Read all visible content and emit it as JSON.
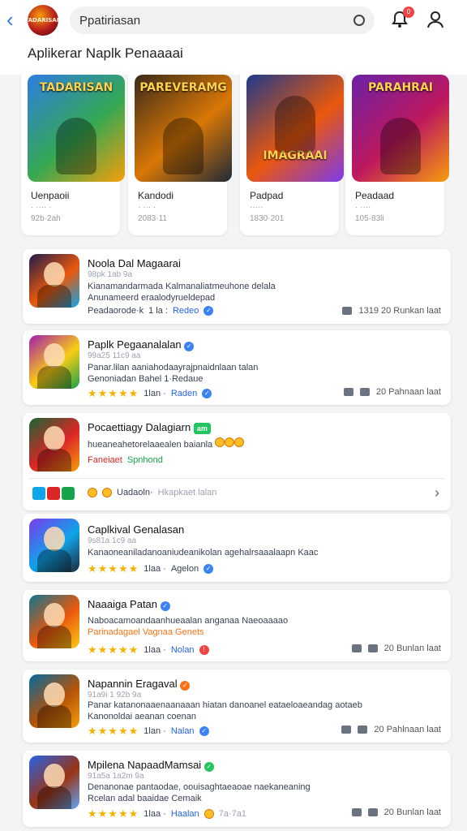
{
  "header": {
    "logo_text": "TADARISAN",
    "search": {
      "value": "Ppatiriasan",
      "placeholder": ""
    },
    "notification_count": "0",
    "subtitle": "Aplikerar Naplk  Penaaaai"
  },
  "featured": [
    {
      "art_title": "TADARISAN",
      "name": "Uenpaoii",
      "meta1": "· ···· ·",
      "meta2": "92b·2ah",
      "colors": [
        "#2f7de1",
        "#35a853",
        "#f59e0b"
      ]
    },
    {
      "art_title": "PAREVERAMG",
      "name": "Kandodi",
      "meta1": "· ··· ·",
      "meta2": "2083·11",
      "colors": [
        "#3a2a1a",
        "#d97706",
        "#1f2937"
      ]
    },
    {
      "art_title": "IMAGRAAI",
      "name": "Padpad",
      "meta1": "·····",
      "meta2": "1830·201",
      "colors": [
        "#1e3a8a",
        "#ea580c",
        "#7c3aed"
      ]
    },
    {
      "art_title": "PARAHRAI",
      "name": "Peadaad",
      "meta1": "· ····",
      "meta2": "105·83li",
      "colors": [
        "#6b21a8",
        "#be185d",
        "#f59e0b"
      ]
    }
  ],
  "list": [
    {
      "title": "Noola Dal Magaarai",
      "meta": "98pk  1ab 9a",
      "desc1": "Kianamandarmada  Kalmanaliatmeuhone  delala",
      "desc2": "Anunameerd eraalodyrueldepad",
      "foot_left": "Peadaorode·k",
      "foot_mid": "1 la :",
      "foot_link": "Redeo",
      "right": "1319  20  Runkan laat",
      "colors": [
        "#1e1b4b",
        "#ea580c",
        "#0ea5e9"
      ]
    },
    {
      "title": "Paplk Pegaanalalan",
      "meta": "99a25  11c9 aa",
      "desc1": "Panar.lilan  aaniahodaayrajpnaidnlaan  talan",
      "desc2": "Genoniadan  Bahel  1·Redaue",
      "stars": "★★★★★",
      "foot_mid": "1lan  ·",
      "foot_link": "Raden",
      "right": "20  Pahnaan laat",
      "colors": [
        "#a21caf",
        "#facc15",
        "#16a34a"
      ]
    },
    {
      "title": "Pocaettiagy Dalagiarn",
      "tag": "am",
      "desc1": "hueaneahetorelaaealen  baianla",
      "foot_red": "Faneiaet",
      "foot_green": "Spnhond",
      "sub_label": "Uadaoln·",
      "sub_desc": "Hkapkaet lalan",
      "colors": [
        "#166534",
        "#dc2626",
        "#f59e0b"
      ]
    },
    {
      "title": "Caplkival Genalasan",
      "meta": "9s81a  1c9 aa",
      "desc1": "Kanaoneaniladanoaniudeanikolan  agehalrsaaalaapn  Kaac",
      "stars": "★★★★★",
      "foot_mid": "1laa ·",
      "foot_link": "Agelon",
      "colors": [
        "#7c3aed",
        "#0ea5e9",
        "#1e293b"
      ]
    },
    {
      "title": "Naaaiga Patan",
      "desc1": "Naboacamoandaanhueaalan  anganaa  Naeoaaaao",
      "desc2": "Parinadagael  Vagnaa  Genets",
      "desc2_orange": true,
      "stars": "★★★★★",
      "foot_mid": "1laa ·",
      "foot_link": "Nolan",
      "right": "20  Bunlan laat",
      "colors": [
        "#0e7490",
        "#ea580c",
        "#facc15"
      ]
    },
    {
      "title": "Napannin Eragaval",
      "meta": "91a9i  1 92b  9a",
      "desc1": "Panar  katanonaaenaanaaan  hiatan  danoanel  eataeloaeandag  aotaeb",
      "desc2": "Kanonoldai  aeanan  coenan",
      "stars": "★★★★★",
      "foot_mid": "1lan  ·",
      "foot_link": "Nalan",
      "right": "20  Pahlnaan laat",
      "colors": [
        "#0369a1",
        "#b45309",
        "#f59e0b"
      ]
    },
    {
      "title": "Mpilena NapaadMamsai",
      "meta": "91a5a  1a2m  9a",
      "desc1": "Denanonae  pantaodae,  oouisaghtaeaoae  naekaneaning",
      "desc2": "Rcelan  adal  baaidae  Cemaik",
      "stars": "★★★★★",
      "foot_mid": "1laa ·",
      "foot_link": "Haalan",
      "foot_extra": "7a·7a1",
      "right": "20  Bunlan laat",
      "colors": [
        "#2563eb",
        "#9a3412",
        "#60a5fa"
      ]
    }
  ]
}
